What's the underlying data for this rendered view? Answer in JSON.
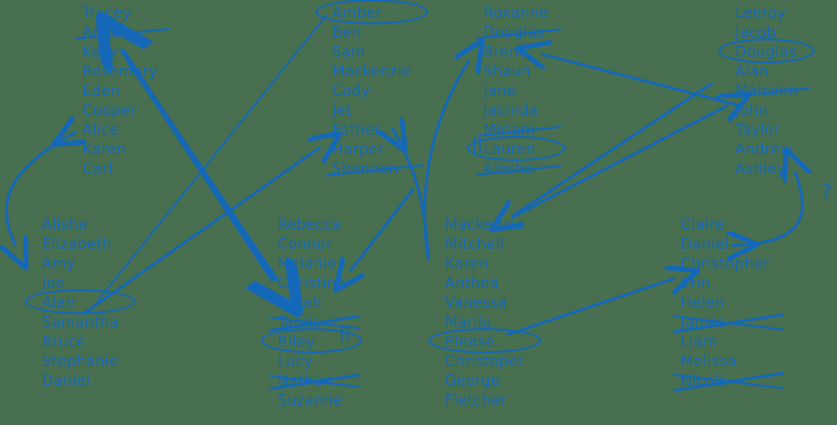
{
  "meta": {
    "ink_color": "#1568B8",
    "background_color": "#487050",
    "question_mark": "?",
    "equals_mark_1": "||",
    "equals_mark_2": "||"
  },
  "columns": [
    {
      "id": "col-top-1",
      "names": [
        {
          "text": "Tracey",
          "struck": false,
          "circled": false
        },
        {
          "text": "Angela",
          "struck": true,
          "circled": false
        },
        {
          "text": "Kelly",
          "struck": false,
          "circled": false
        },
        {
          "text": "Rosemary",
          "struck": false,
          "circled": false
        },
        {
          "text": "Eden",
          "struck": false,
          "circled": false
        },
        {
          "text": "Cooper",
          "struck": false,
          "circled": false
        },
        {
          "text": "Alice",
          "struck": false,
          "circled": false
        },
        {
          "text": "Karen",
          "struck": false,
          "circled": false
        },
        {
          "text": "Carl",
          "struck": false,
          "circled": false
        }
      ]
    },
    {
      "id": "col-top-2",
      "names": [
        {
          "text": "Amber",
          "struck": false,
          "circled": true
        },
        {
          "text": "Ben",
          "struck": false,
          "circled": false
        },
        {
          "text": "Sam",
          "struck": false,
          "circled": false
        },
        {
          "text": "Mackenzie",
          "struck": false,
          "circled": false
        },
        {
          "text": "Cody",
          "struck": false,
          "circled": false
        },
        {
          "text": "Jet",
          "struck": false,
          "circled": false
        },
        {
          "text": "Esther",
          "struck": false,
          "circled": false
        },
        {
          "text": "Harper",
          "struck": false,
          "circled": false
        },
        {
          "text": "Shannon",
          "struck": true,
          "circled": false
        }
      ]
    },
    {
      "id": "col-top-3",
      "names": [
        {
          "text": "Roxanne",
          "struck": false,
          "circled": false
        },
        {
          "text": "Douglas",
          "struck": true,
          "circled": false
        },
        {
          "text": "Brent",
          "struck": false,
          "circled": false
        },
        {
          "text": "Shaun",
          "struck": false,
          "circled": false
        },
        {
          "text": "Jane",
          "struck": false,
          "circled": false
        },
        {
          "text": "Jacinda",
          "struck": false,
          "circled": false
        },
        {
          "text": "Miriam",
          "struck": true,
          "circled": false
        },
        {
          "text": "Lauren",
          "struck": false,
          "circled": true
        },
        {
          "text": "Alesha",
          "struck": true,
          "circled": false
        }
      ]
    },
    {
      "id": "col-top-4",
      "names": [
        {
          "text": "Leeroy",
          "struck": false,
          "circled": false
        },
        {
          "text": "Jacob",
          "struck": false,
          "circled": false
        },
        {
          "text": "Douglas",
          "struck": false,
          "circled": true
        },
        {
          "text": "Alan",
          "struck": false,
          "circled": false
        },
        {
          "text": "Malcolm",
          "struck": true,
          "circled": false
        },
        {
          "text": "John",
          "struck": false,
          "circled": false
        },
        {
          "text": "Taylor",
          "struck": false,
          "circled": false
        },
        {
          "text": "Andrew",
          "struck": false,
          "circled": false
        },
        {
          "text": "Ashley",
          "struck": false,
          "circled": false
        }
      ]
    },
    {
      "id": "col-bottom-1",
      "names": [
        {
          "text": "Alisha",
          "struck": false,
          "circled": false
        },
        {
          "text": "Elizabeth",
          "struck": false,
          "circled": false
        },
        {
          "text": "Amy",
          "struck": false,
          "circled": false
        },
        {
          "text": "Joe",
          "struck": false,
          "circled": false
        },
        {
          "text": "Alan",
          "struck": false,
          "circled": true
        },
        {
          "text": "Samantha",
          "struck": false,
          "circled": false
        },
        {
          "text": "Bruce",
          "struck": false,
          "circled": false
        },
        {
          "text": "Stephanie",
          "struck": false,
          "circled": false
        },
        {
          "text": "Daniel",
          "struck": false,
          "circled": false
        }
      ]
    },
    {
      "id": "col-bottom-2",
      "names": [
        {
          "text": "Rebecca",
          "struck": false,
          "circled": false
        },
        {
          "text": "Connor",
          "struck": false,
          "circled": false
        },
        {
          "text": "Melanie",
          "struck": false,
          "circled": false
        },
        {
          "text": "Christine",
          "struck": false,
          "circled": false
        },
        {
          "text": "Sarah",
          "struck": false,
          "circled": false
        },
        {
          "text": "Tamia",
          "struck": true,
          "circled": false
        },
        {
          "text": "Riley",
          "struck": false,
          "circled": true
        },
        {
          "text": "Lucy",
          "struck": false,
          "circled": false
        },
        {
          "text": "Nathan",
          "struck": true,
          "circled": false
        },
        {
          "text": "Suzanne",
          "struck": false,
          "circled": false
        }
      ]
    },
    {
      "id": "col-bottom-3",
      "names": [
        {
          "text": "Mackenzie",
          "struck": false,
          "circled": false
        },
        {
          "text": "Mitchell",
          "struck": false,
          "circled": false
        },
        {
          "text": "Karen",
          "struck": false,
          "circled": false
        },
        {
          "text": "Anthea",
          "struck": false,
          "circled": false
        },
        {
          "text": "Vanessa",
          "struck": false,
          "circled": false
        },
        {
          "text": "Marilu",
          "struck": false,
          "circled": false
        },
        {
          "text": "Elease",
          "struck": false,
          "circled": true
        },
        {
          "text": "Christoper",
          "struck": false,
          "circled": false
        },
        {
          "text": "George",
          "struck": false,
          "circled": false
        },
        {
          "text": "Fletcher",
          "struck": false,
          "circled": false
        }
      ]
    },
    {
      "id": "col-bottom-4",
      "names": [
        {
          "text": "Claire",
          "struck": false,
          "circled": false
        },
        {
          "text": "Daniel",
          "struck": false,
          "circled": false
        },
        {
          "text": "Christopher",
          "struck": false,
          "circled": false
        },
        {
          "text": "Erin",
          "struck": false,
          "circled": false
        },
        {
          "text": "Helen",
          "struck": false,
          "circled": false
        },
        {
          "text": "James",
          "struck": true,
          "circled": false
        },
        {
          "text": "Liam",
          "struck": false,
          "circled": false
        },
        {
          "text": "Melissa",
          "struck": false,
          "circled": false
        },
        {
          "text": "Nicole",
          "struck": true,
          "circled": false
        }
      ]
    }
  ]
}
